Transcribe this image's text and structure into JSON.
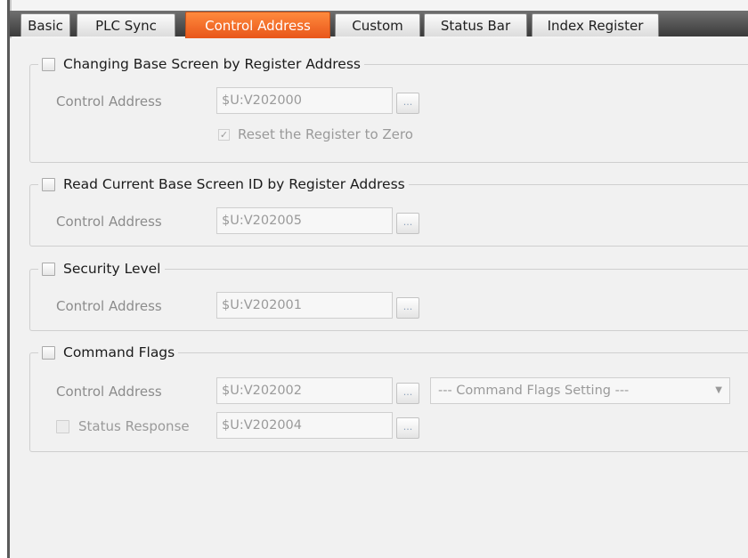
{
  "tabs": [
    {
      "label": "Basic"
    },
    {
      "label": "PLC Sync"
    },
    {
      "label": "Control Address"
    },
    {
      "label": "Custom"
    },
    {
      "label": "Status Bar"
    },
    {
      "label": "Index Register"
    }
  ],
  "colors": {
    "active_tab": "#e8561a",
    "tab_strip": "#3a3a3a"
  },
  "groups": {
    "change_screen": {
      "title": "Changing Base Screen by Register Address",
      "control_address_label": "Control Address",
      "control_address_value": "$U:V202000",
      "browse_label": "...",
      "reset_label": "Reset the Register to Zero",
      "reset_checked": true
    },
    "read_screen": {
      "title": "Read Current Base Screen ID by Register Address",
      "control_address_label": "Control Address",
      "control_address_value": "$U:V202005",
      "browse_label": "..."
    },
    "security": {
      "title": "Security Level",
      "control_address_label": "Control Address",
      "control_address_value": "$U:V202001",
      "browse_label": "..."
    },
    "command_flags": {
      "title": "Command Flags",
      "control_address_label": "Control Address",
      "control_address_value": "$U:V202002",
      "browse_label": "...",
      "setting_select": "--- Command Flags Setting ---",
      "status_response_label": "Status Response",
      "status_response_value": "$U:V202004",
      "status_browse_label": "..."
    }
  },
  "icons": {
    "reset_check": "✓",
    "dropdown_arrow": "▼"
  }
}
